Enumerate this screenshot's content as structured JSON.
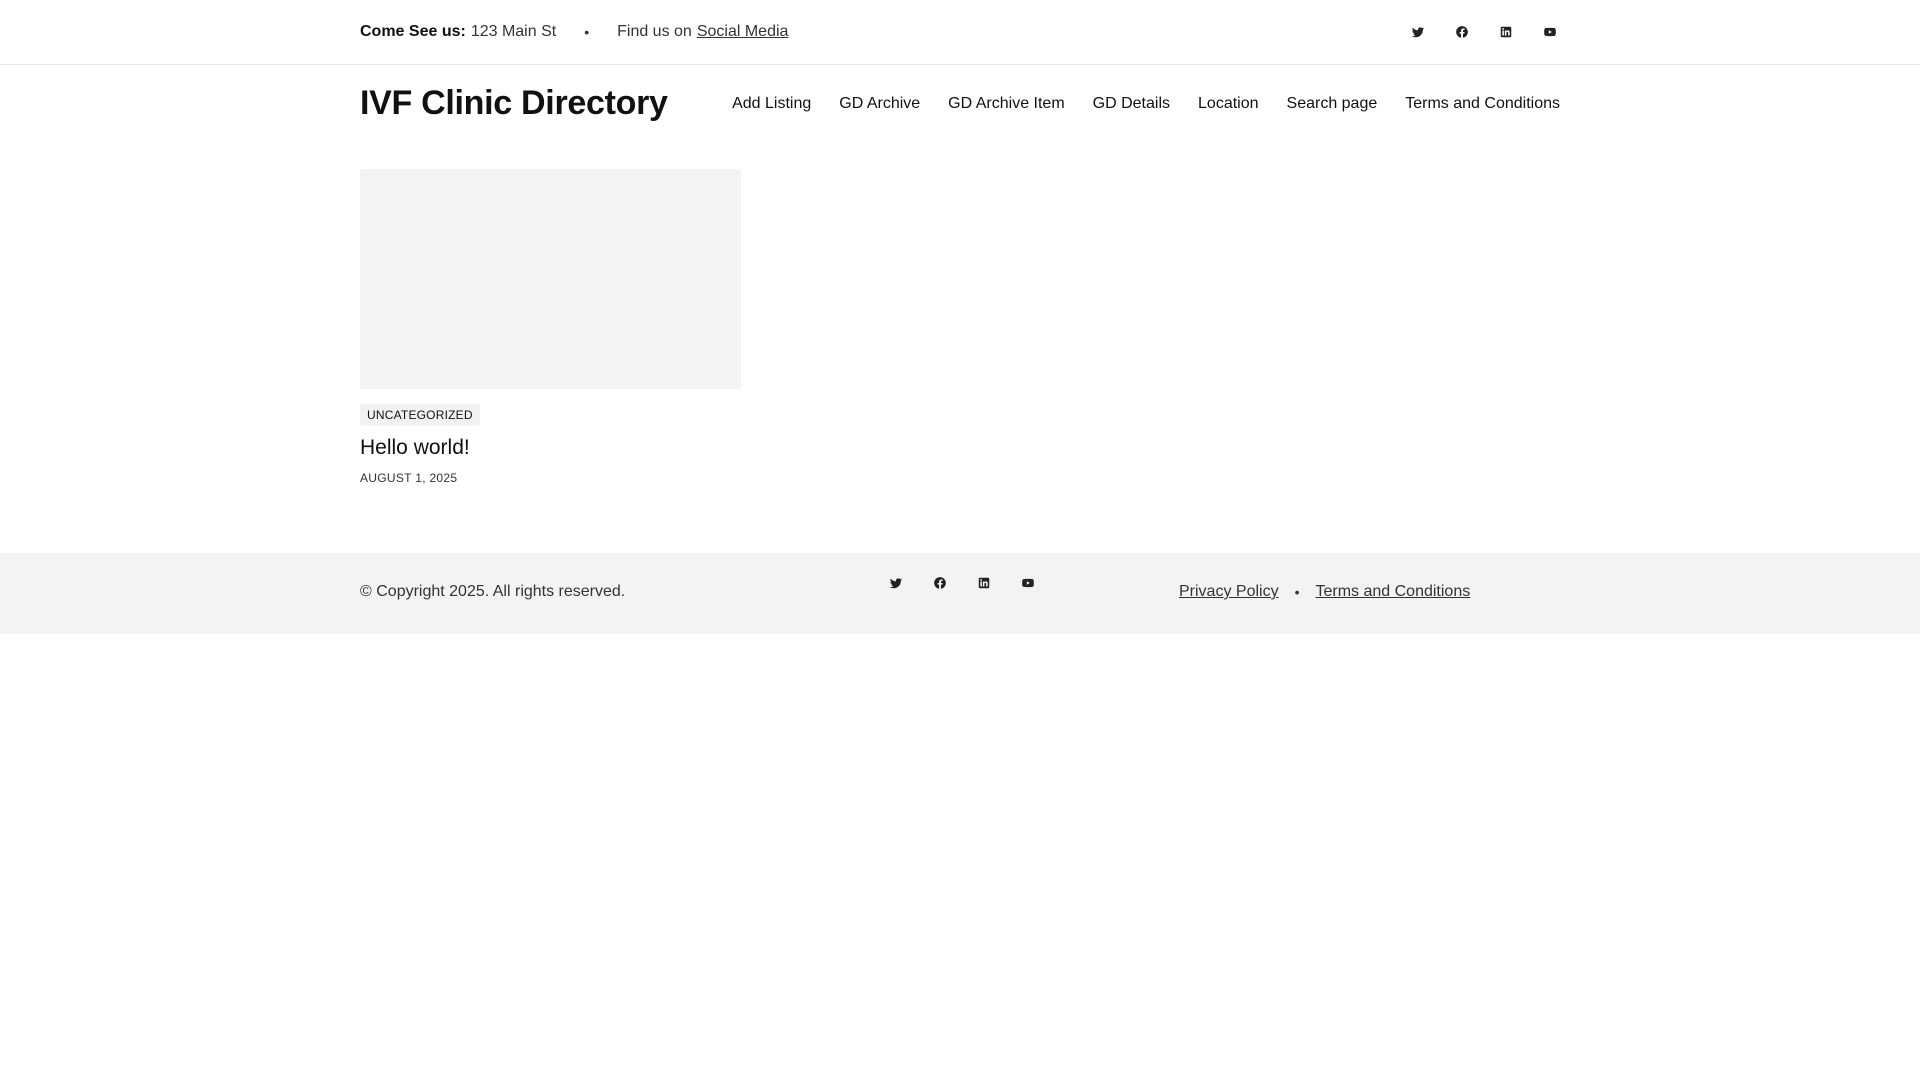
{
  "topbar": {
    "address_label": "Come See us:",
    "address_value": "123 Main St",
    "separator": "•",
    "social_prefix": "Find us on",
    "social_link": "Social Media",
    "icons": [
      "twitter-icon",
      "facebook-icon",
      "linkedin-icon",
      "youtube-icon"
    ]
  },
  "header": {
    "site_title": "IVF Clinic Directory",
    "nav": [
      "Add Listing",
      "GD Archive",
      "GD Archive Item",
      "GD Details",
      "Location",
      "Search page",
      "Terms and Conditions"
    ]
  },
  "post": {
    "category": "UNCATEGORIZED",
    "title": "Hello world!",
    "date": "AUGUST 1, 2025"
  },
  "footer": {
    "copyright": "© Copyright 2025. All rights reserved.",
    "icons": [
      "twitter-icon",
      "facebook-icon",
      "linkedin-icon",
      "youtube-icon"
    ],
    "links": [
      "Privacy Policy",
      "Terms and Conditions"
    ],
    "separator": "•"
  },
  "colors": {
    "text": "#111111",
    "muted": "#333333",
    "placeholder": "#f3f3f3",
    "footer_bg": "#f3f3f3",
    "border": "#e6e6e6"
  }
}
